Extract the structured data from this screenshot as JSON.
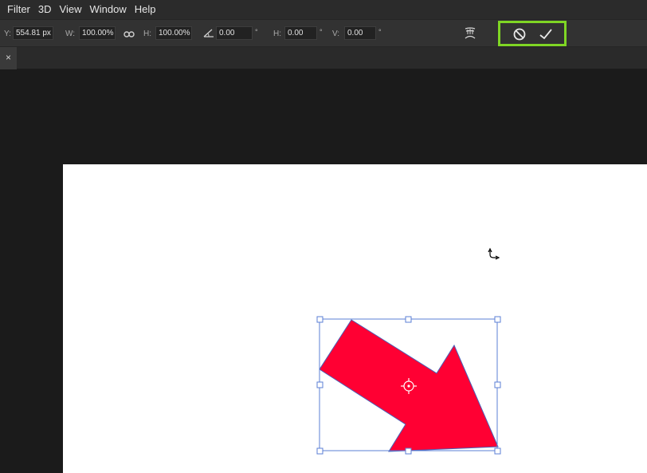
{
  "menu": [
    "Filter",
    "3D",
    "View",
    "Window",
    "Help"
  ],
  "options": {
    "y_label": "Y:",
    "y_value": "554.81 px",
    "w_label": "W:",
    "w_value": "100.00%",
    "h_label": "H:",
    "h_value": "100.00%",
    "angle_value": "0.00",
    "angle_unit": "°",
    "skew_h_label": "H:",
    "skew_h_value": "0.00",
    "skew_h_unit": "°",
    "skew_v_label": "V:",
    "skew_v_value": "0.00",
    "skew_v_unit": "°",
    "icons": {
      "link": "link-icon",
      "angle": "angle-icon",
      "warp": "warp-icon",
      "cancel": "cancel-transform-icon",
      "commit": "commit-checkmark-icon"
    },
    "highlight_color": "#7fd624"
  },
  "tab": {
    "close_glyph": "×"
  },
  "canvas": {
    "background": "#ffffff",
    "shape_color": "#ff0033",
    "bounding_box_color": "#5b7fd6"
  }
}
